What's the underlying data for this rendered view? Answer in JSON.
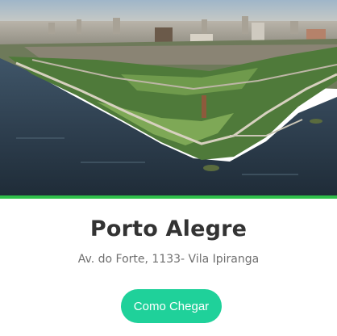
{
  "venue": {
    "title": "Porto Alegre",
    "address": "Av. do Forte, 1133- Vila Ipiranga",
    "cta_label": "Como Chegar"
  },
  "colors": {
    "accent_bar": "#2fbf4a",
    "button": "#1fd19a",
    "title_text": "#333333",
    "address_text": "#6f6f6f"
  }
}
